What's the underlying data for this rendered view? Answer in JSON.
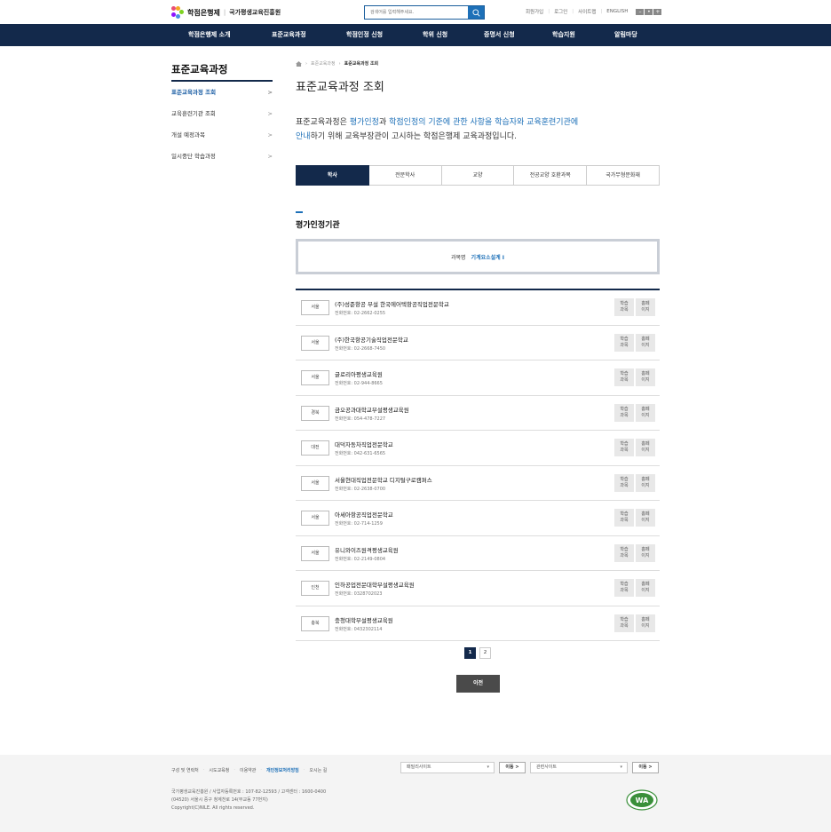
{
  "header": {
    "logo_main": "학점은행제",
    "logo_sep": "|",
    "logo_org": "국가평생교육진흥원",
    "search_placeholder": "검색어를 입력해주세요.",
    "util_links": [
      "회원가입",
      "로그인",
      "사이트맵",
      "ENGLISH"
    ],
    "font_controls": [
      "–",
      "•",
      "+"
    ]
  },
  "gnb": [
    "학점은행제 소개",
    "표준교육과정",
    "학점인정 신청",
    "학위 신청",
    "증명서 신청",
    "학습지원",
    "알림마당"
  ],
  "lnb": {
    "title": "표준교육과정",
    "items": [
      "표준교육과정 조회",
      "교육훈련기관 조회",
      "개설 예정과목",
      "일시중단 학습과정"
    ],
    "arrow": ">"
  },
  "breadcrumb": [
    "표준교육과정",
    "표준교육과정 조회"
  ],
  "page_title": "표준교육과정 조회",
  "intro": {
    "p1": "표준교육과정은 ",
    "h1": "평가인정",
    "p2": "과 ",
    "h2": "학점인정의 기준에 관한 사항을 학습자와 교육훈련기관에",
    "h3": "안내",
    "p3": "하기 위해 교육부장관이 고시하는 학점은행제 교육과정입니다."
  },
  "tabs": [
    "학사",
    "전문학사",
    "교양",
    "전공교양 호환과목",
    "국가무형문화재"
  ],
  "section_title": "평가인정기관",
  "course": {
    "label": "과목명",
    "value": "기계요소설계 I"
  },
  "row_buttons": [
    [
      "학습",
      "과목"
    ],
    [
      "홈페",
      "이지"
    ]
  ],
  "institutions": [
    {
      "region": "서울",
      "name": "(주)성준항공 부설 한국에어텍항공직업전문학교",
      "tel": "전화번호: 02-2662-0255"
    },
    {
      "region": "서울",
      "name": "(주)한국항공기술직업전문학교",
      "tel": "전화번호: 02-2668-7450"
    },
    {
      "region": "서울",
      "name": "글로리아평생교육원",
      "tel": "전화번호: 02-944-8665"
    },
    {
      "region": "경북",
      "name": "금오공과대학교부설평생교육원",
      "tel": "전화번호: 054-478-7227"
    },
    {
      "region": "대전",
      "name": "대덕자동차직업전문학교",
      "tel": "전화번호: 042-631-6565"
    },
    {
      "region": "서울",
      "name": "서울현대직업전문학교 디지털구로캠퍼스",
      "tel": "전화번호: 02-2638-0700"
    },
    {
      "region": "서울",
      "name": "아세아항공직업전문학교",
      "tel": "전화번호: 02-714-1259"
    },
    {
      "region": "서울",
      "name": "유니와이즈원격평생교육원",
      "tel": "전화번호: 02-2149-0804"
    },
    {
      "region": "인천",
      "name": "인하공업전문대학부설평생교육원",
      "tel": "전화번호: 0328702023"
    },
    {
      "region": "충북",
      "name": "충청대학부설평생교육원",
      "tel": "전화번호: 0432302114"
    }
  ],
  "pagination": [
    "1",
    "2"
  ],
  "prev_button": "이전",
  "footer": {
    "links": [
      "구성 및 연락처",
      "시도교육청",
      "이용약관",
      "개인정보처리방침",
      "오시는 길"
    ],
    "family_site": "패밀리사이트",
    "related_site": "관련사이트",
    "go_label": "이동 >",
    "info": [
      "국가평생교육진흥원 / 사업자등록번호 : 107-82-12593 / 고객센터 : 1600-0400",
      "(04520) 서울시 중구 청계천로 14(무교동 77번지)",
      "Copyright(C)NILE. All rights reserved."
    ],
    "mark_text": "WA"
  }
}
